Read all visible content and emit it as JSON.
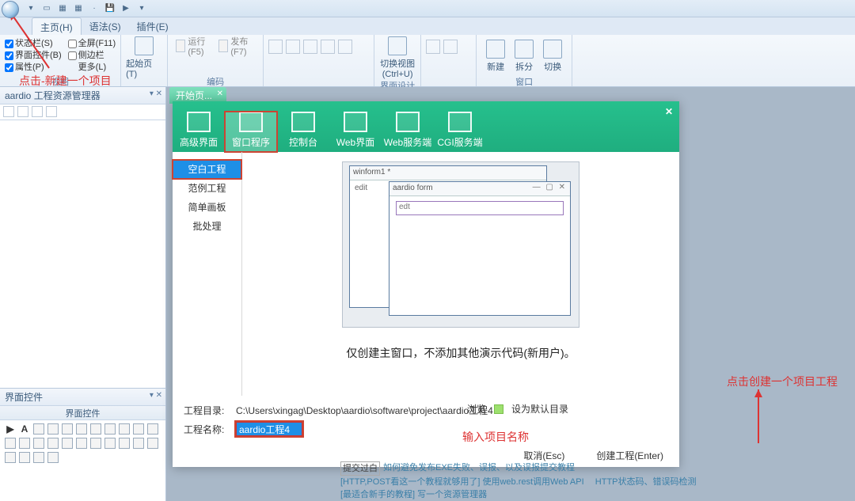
{
  "qat_icons": [
    "folder",
    "disk",
    "db",
    "save",
    "saveall",
    "undo",
    "dd"
  ],
  "tabs": {
    "a": "主页(H)",
    "b": "语法(S)",
    "c": "插件(E)"
  },
  "ribbon": {
    "g1": {
      "c1": "状态栏(S)",
      "c2": "界面控件(B)",
      "c3": "属性(P)",
      "c4": "全屏(F11)",
      "c5": "侧边栏",
      "c6": "更多(L)",
      "lbl": "视图"
    },
    "g2": {
      "btn": "起始页(T)"
    },
    "g3": {
      "a": "运行(F5)",
      "b": "发布(F7)",
      "lbl": "编码"
    },
    "g4": {
      "lbl": ""
    },
    "g5": {
      "a": "切换视图\n(Ctrl+U)",
      "lbl": "界面设计"
    },
    "g6": {
      "lbl": ""
    },
    "g7": {
      "a": "新建",
      "b": "拆分",
      "c": "切换",
      "lbl": "窗口"
    }
  },
  "dock": {
    "proj": "aardio 工程资源管理器",
    "ctrl": "界面控件",
    "ctrlhdr": "界面控件"
  },
  "doctab": "开始页...",
  "top": {
    "t0": "高级界面",
    "t1": "窗口程序",
    "t2": "控制台",
    "t3": "Web界面",
    "t4": "Web服务端",
    "t5": "CGI服务端"
  },
  "left": {
    "l0": "空白工程",
    "l1": "范例工程",
    "l2": "简单画板",
    "l3": "批处理"
  },
  "preview": {
    "frame1": "winform1 *",
    "frame2": "aardio form",
    "ed": "edit",
    "ed2": "edt"
  },
  "desc": "仅创建主窗口，不添加其他演示代码(新用户)。",
  "foot": {
    "dirlab": "工程目录:",
    "dir": "C:\\Users\\xingag\\Desktop\\aardio\\software\\project\\aardio工程4",
    "namelab": "工程名称:",
    "name": "aardio工程4",
    "browse": "浏览",
    "setdef": "设为默认目录",
    "cancel": "取消(Esc)",
    "create": "创建工程(Enter)"
  },
  "ann": {
    "a1": "点击-新建一个项目",
    "a2": "输入项目名称",
    "a3": "点击创建一个项目工程"
  },
  "feed": {
    "l1a": "提交过白",
    "l1b": "如何避免发布EXE失败、误报、以及误报提交教程",
    "l2a": "[HTTP,POST看这一个教程就够用了] 使用web.rest调用Web API",
    "l2b": "HTTP状态码、错误码检测",
    "l3": "[最适合新手的教程] 写一个资源管理器"
  }
}
